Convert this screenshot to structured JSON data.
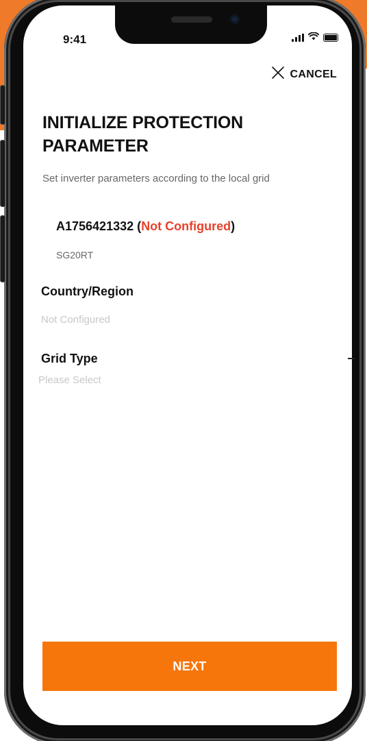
{
  "status_bar": {
    "time": "9:41",
    "icons": [
      "cellular-signal-icon",
      "wifi-icon",
      "battery-icon"
    ]
  },
  "header": {
    "cancel_label": "CANCEL",
    "cancel_icon": "close-icon"
  },
  "page": {
    "title": "INITIALIZE PROTECTION PARAMETER",
    "subtitle": "Set inverter parameters according to the local grid"
  },
  "device": {
    "serial": "A1756421332",
    "status_open": " (",
    "status": "Not Configured",
    "status_close": ")",
    "model": "SG20RT"
  },
  "fields": {
    "country": {
      "label": "Country/Region",
      "value": "Not Configured"
    },
    "grid_type": {
      "label": "Grid Type",
      "placeholder": "Please Select"
    }
  },
  "footer": {
    "next_label": "NEXT"
  },
  "colors": {
    "accent": "#f6760c",
    "background_orange": "#ef7a2a",
    "status_red": "#e8412b",
    "text_dark": "#111111",
    "text_muted": "#666666",
    "placeholder": "#c8c8c8"
  }
}
